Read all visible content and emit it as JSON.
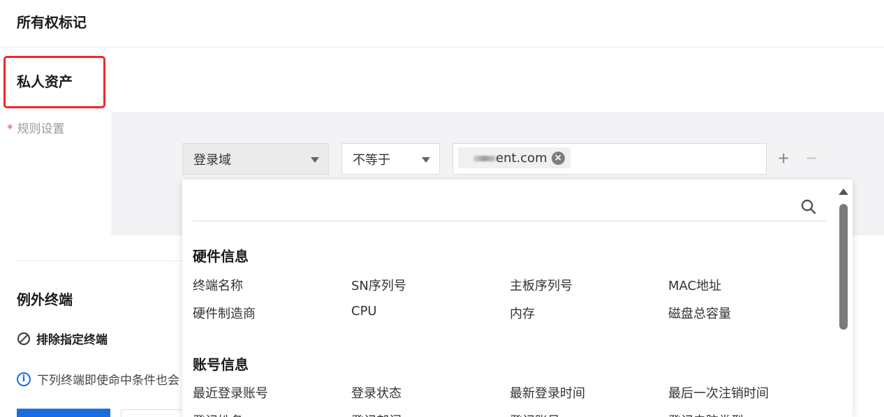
{
  "page": {
    "ownership_title": "所有权标记",
    "private_assets_title": "私人资产",
    "exception_title": "例外终端",
    "exclude_label": "排除指定终端",
    "info_text": "下列终端即使命中条件也会"
  },
  "rule": {
    "label": "规则设置",
    "required_mark": "*",
    "field_select": "登录域",
    "operator_select": "不等于",
    "tag_value": "ent.com",
    "add_symbol": "+",
    "remove_symbol": "−"
  },
  "dropdown": {
    "search_placeholder": "",
    "groups": [
      {
        "title": "硬件信息",
        "options": [
          "终端名称",
          "SN序列号",
          "主板序列号",
          "MAC地址",
          "硬件制造商",
          "CPU",
          "内存",
          "磁盘总容量"
        ]
      },
      {
        "title": "账号信息",
        "options": [
          "最近登录账号",
          "登录状态",
          "最新登录时间",
          "最后一次注销时间",
          "登记姓名",
          "登记部门",
          "登记账号",
          "登记电脑类型"
        ]
      }
    ]
  },
  "icons": {
    "search": "search-icon",
    "clear": "clear-icon",
    "exclude": "exclude-icon",
    "info": "info-icon",
    "caret": "caret-down-icon"
  },
  "colors": {
    "highlight": "#f0262c",
    "primary": "#1a6de0",
    "required": "#e54545"
  }
}
